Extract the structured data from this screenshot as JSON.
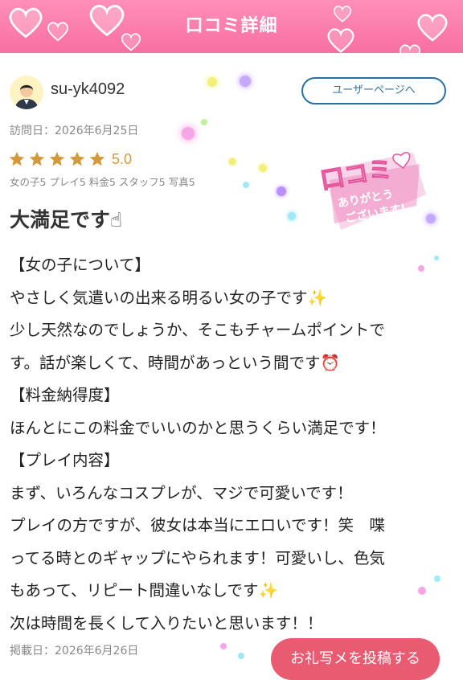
{
  "header": {
    "title": "口コミ詳細"
  },
  "reviewer": {
    "username": "su-yk4092",
    "user_page_label": "ユーザーページへ"
  },
  "review": {
    "visit_date": "訪問日：2026年6月25日",
    "rating": {
      "stars": 5,
      "score_text": "5.0",
      "sub_scores": "女の子5 プレイ5 料金5 スタッフ5 写真5"
    },
    "headline": "大満足です☝",
    "body_lines": [
      "【女の子について】",
      "やさしく気遣いの出来る明るい女の子です✨",
      "少し天然なのでしょうか、そこもチャームポイントで",
      "す。話が楽しくて、時間があっという間です⏰",
      "【料金納得度】",
      "ほんとにこの料金でいいのかと思うくらい満足です！",
      "【プレイ内容】",
      "まず、いろんなコスプレが、マジで可愛いです！",
      "プレイの方ですが、彼女は本当にエロいです！笑　喋",
      "ってる時とのギャップにやられます！可愛いし、色気",
      "もあって、リピート間違いなしです✨",
      "次は時間を長くして入りたいと思います！！"
    ],
    "posted_date": "掲載日：2026年6月26日"
  },
  "badge": {
    "line1": "口コミ",
    "line2": "ありがとう",
    "line3": "ございます!"
  },
  "actions": {
    "post_photo_label": "お礼写メを投稿する"
  },
  "colors": {
    "header_pink": "#f86fa2",
    "star_gold": "#d39a3c",
    "button_blue": "#2b6f9e",
    "cta_red": "#e85b70"
  }
}
